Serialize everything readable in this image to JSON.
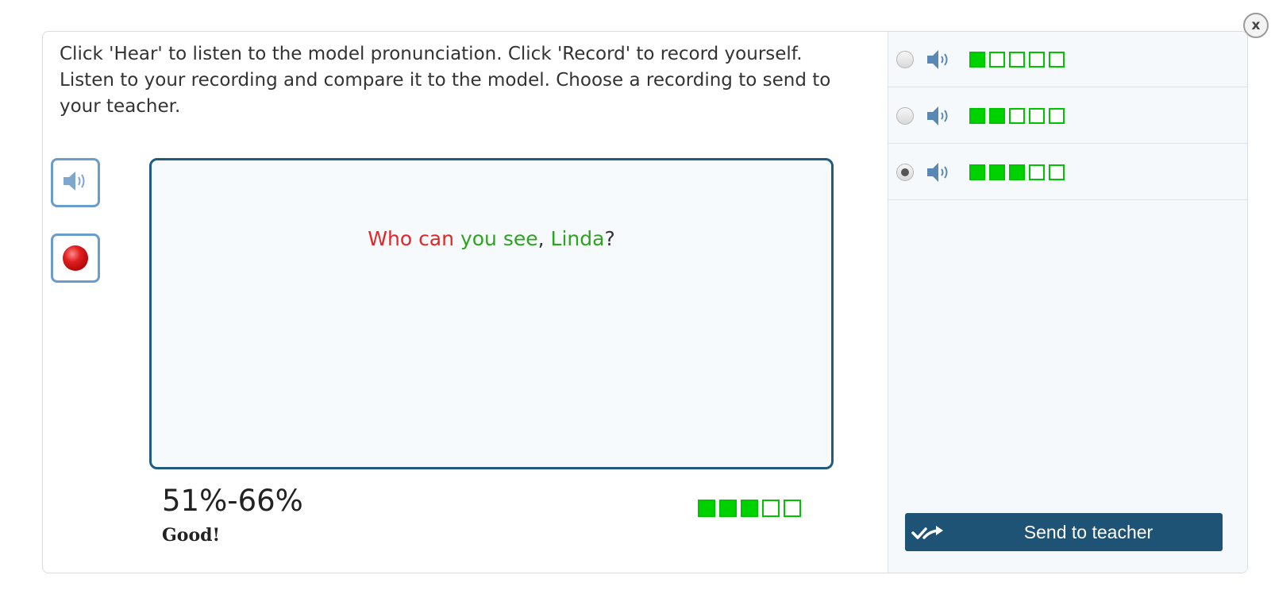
{
  "close": {
    "label": "x"
  },
  "instructions": "Click 'Hear' to listen to the model pronunciation. Click 'Record' to record yourself. Listen to your recording and compare it to the model. Choose a recording to send to your teacher.",
  "sentence": {
    "words": [
      {
        "text": "Who",
        "status": "incorrect"
      },
      {
        "text": " ",
        "status": "none"
      },
      {
        "text": "can",
        "status": "incorrect"
      },
      {
        "text": " ",
        "status": "none"
      },
      {
        "text": "you",
        "status": "correct"
      },
      {
        "text": " ",
        "status": "none"
      },
      {
        "text": "see",
        "status": "correct"
      },
      {
        "text": ", ",
        "status": "none"
      },
      {
        "text": "Linda",
        "status": "correct"
      },
      {
        "text": "?",
        "status": "none"
      }
    ]
  },
  "buttons": {
    "hear_icon": "speaker-icon",
    "record_icon": "record-icon"
  },
  "score": {
    "range": "51%-66%",
    "label": "Good!",
    "level": 3,
    "max": 5
  },
  "recordings": [
    {
      "selected": false,
      "level": 1,
      "max": 5
    },
    {
      "selected": false,
      "level": 2,
      "max": 5
    },
    {
      "selected": true,
      "level": 3,
      "max": 5
    }
  ],
  "send": {
    "label": "Send to teacher",
    "icon": "check-arrow-icon"
  },
  "colors": {
    "incorrect": "#e42626",
    "correct": "#2ea31f",
    "meter_fill": "#00d200",
    "accent": "#1f5376",
    "button_border": "#6a9ccc"
  }
}
